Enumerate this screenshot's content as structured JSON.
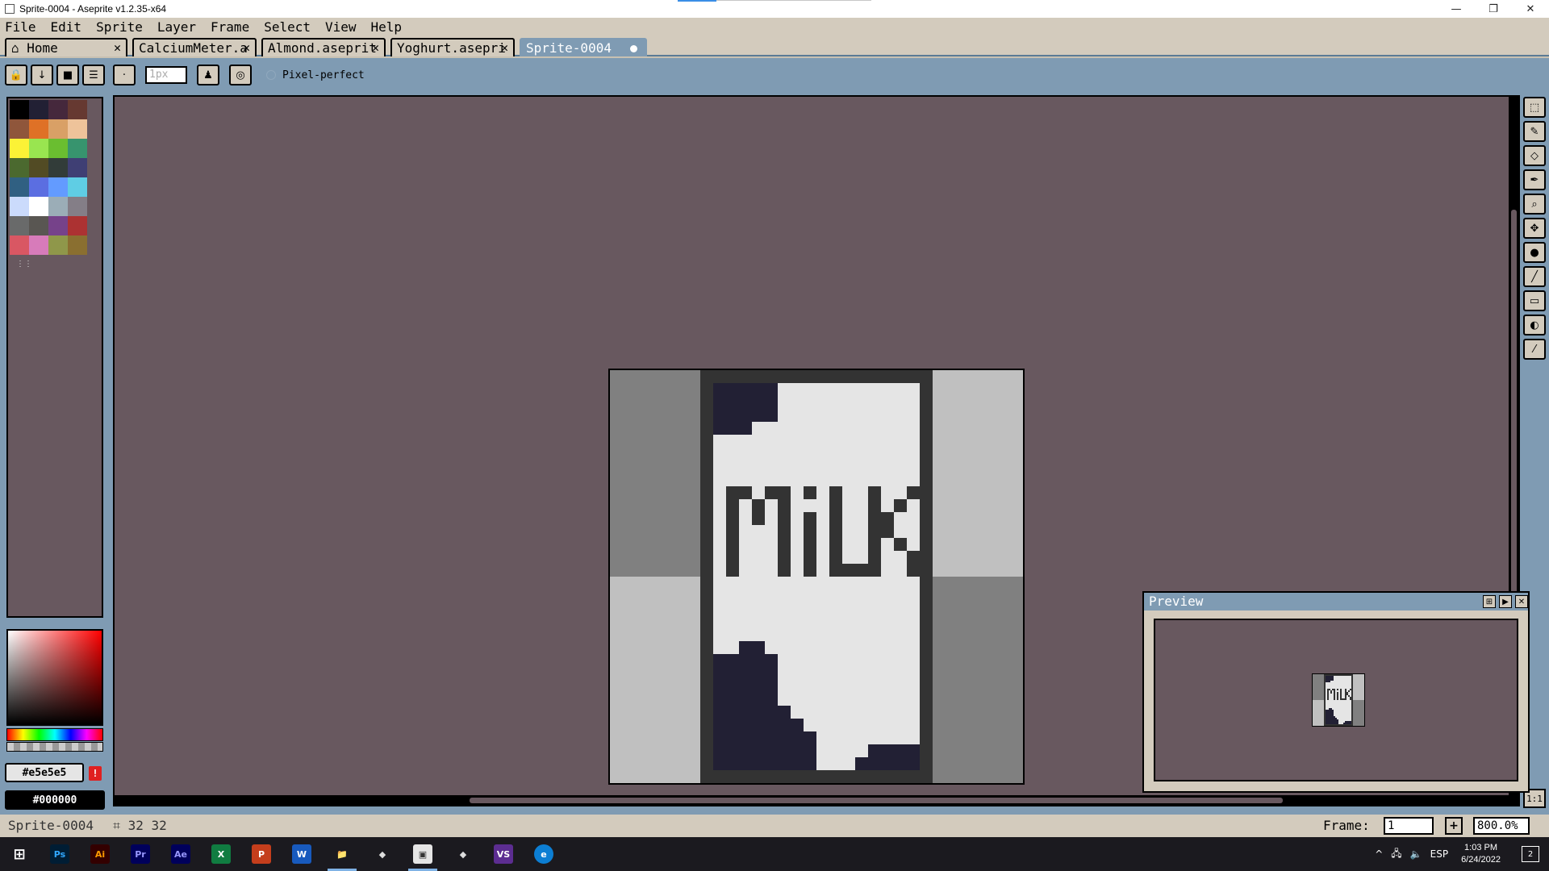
{
  "window": {
    "title": "Sprite-0004 - Aseprite v1.2.35-x64",
    "minimize": "—",
    "maximize": "❐",
    "close": "✕"
  },
  "menu": [
    "File",
    "Edit",
    "Sprite",
    "Layer",
    "Frame",
    "Select",
    "View",
    "Help"
  ],
  "tabs": [
    {
      "label": "⌂ Home",
      "close": "✕"
    },
    {
      "label": "CalciumMeter.a",
      "close": "✕"
    },
    {
      "label": "Almond.aseprit",
      "close": "✕"
    },
    {
      "label": "Yoghurt.asepri",
      "close": "✕"
    },
    {
      "label": "Sprite-0004",
      "close": ""
    }
  ],
  "contextbar": {
    "brush_size_placeholder": "1px",
    "pixel_perfect_label": "Pixel-perfect"
  },
  "palette": [
    "#000000",
    "#222034",
    "#45283c",
    "#663931",
    "#8f563b",
    "#df7126",
    "#d9a066",
    "#eec39a",
    "#fbf236",
    "#99e550",
    "#6abe30",
    "#37946e",
    "#4b692f",
    "#524b24",
    "#323c39",
    "#3f3f74",
    "#306082",
    "#5b6ee1",
    "#639bff",
    "#5fcde4",
    "#cbdbfc",
    "#ffffff",
    "#9badb7",
    "#847e87",
    "#696a6a",
    "#595652",
    "#76428a",
    "#ac3232",
    "#d95763",
    "#d77bba",
    "#8f974a",
    "#8a6f30"
  ],
  "colors": {
    "foreground_hex": "#e5e5e5",
    "background_hex": "#000000",
    "canvas_bg": "#68585f",
    "ui_panel": "#d3cbbd",
    "ui_accent": "#7f9bb3"
  },
  "sprite": {
    "text": "MILK",
    "width": 32,
    "height": 32
  },
  "preview": {
    "title": "Preview"
  },
  "status": {
    "sprite_name": "Sprite-0004",
    "size_label": "⌗ 32 32",
    "frame_label": "Frame:",
    "frame_value": "1",
    "zoom_value": "800.0%"
  },
  "taskbar": {
    "apps": [
      "Ps",
      "Ai",
      "Pr",
      "Ae",
      "X",
      "P",
      "W",
      "📁",
      "◆",
      "▣",
      "◆",
      "VS",
      "e"
    ],
    "lang": "ESP",
    "time": "1:03 PM",
    "date": "6/24/2022",
    "notifications": "2"
  }
}
